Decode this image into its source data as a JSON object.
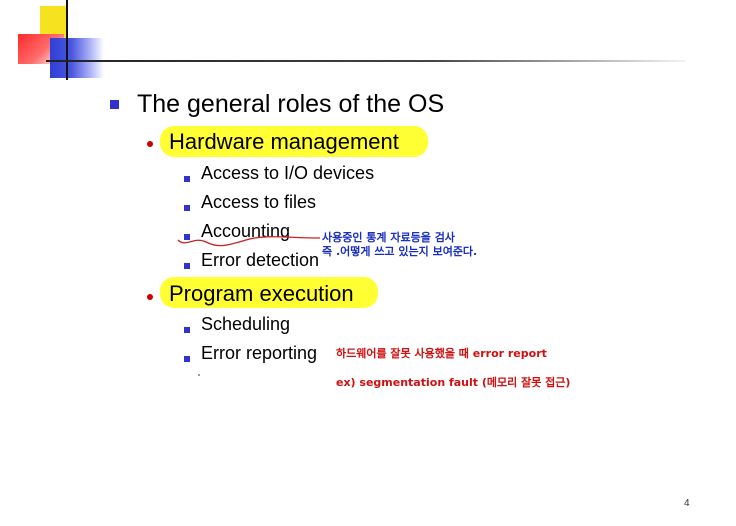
{
  "slide": {
    "title": "The general roles of the OS",
    "sections": [
      {
        "label": "Hardware management",
        "items": [
          "Access to I/O devices",
          "Access to files",
          "Accounting",
          "Error detection"
        ]
      },
      {
        "label": "Program execution",
        "items": [
          "Scheduling",
          "Error reporting"
        ]
      }
    ],
    "annotations": {
      "accounting_line1": "사용중인 통계 자료등을 검사",
      "accounting_line2": "즉 .어떻게 쓰고 있는지 보여준다.",
      "error_report_line1": "하드웨어를 잘못 사용했을 때 error report",
      "error_report_line2": "ex) segmentation fault (메모리 잘못 접근)"
    },
    "page_number": "4"
  },
  "colors": {
    "bullet_square": "#3333cc",
    "bullet_dot": "#cc0000",
    "highlight": "#ffff33",
    "annotation_blue": "#1a2fbf",
    "annotation_red": "#d01010",
    "underline_red": "#cc2222"
  }
}
